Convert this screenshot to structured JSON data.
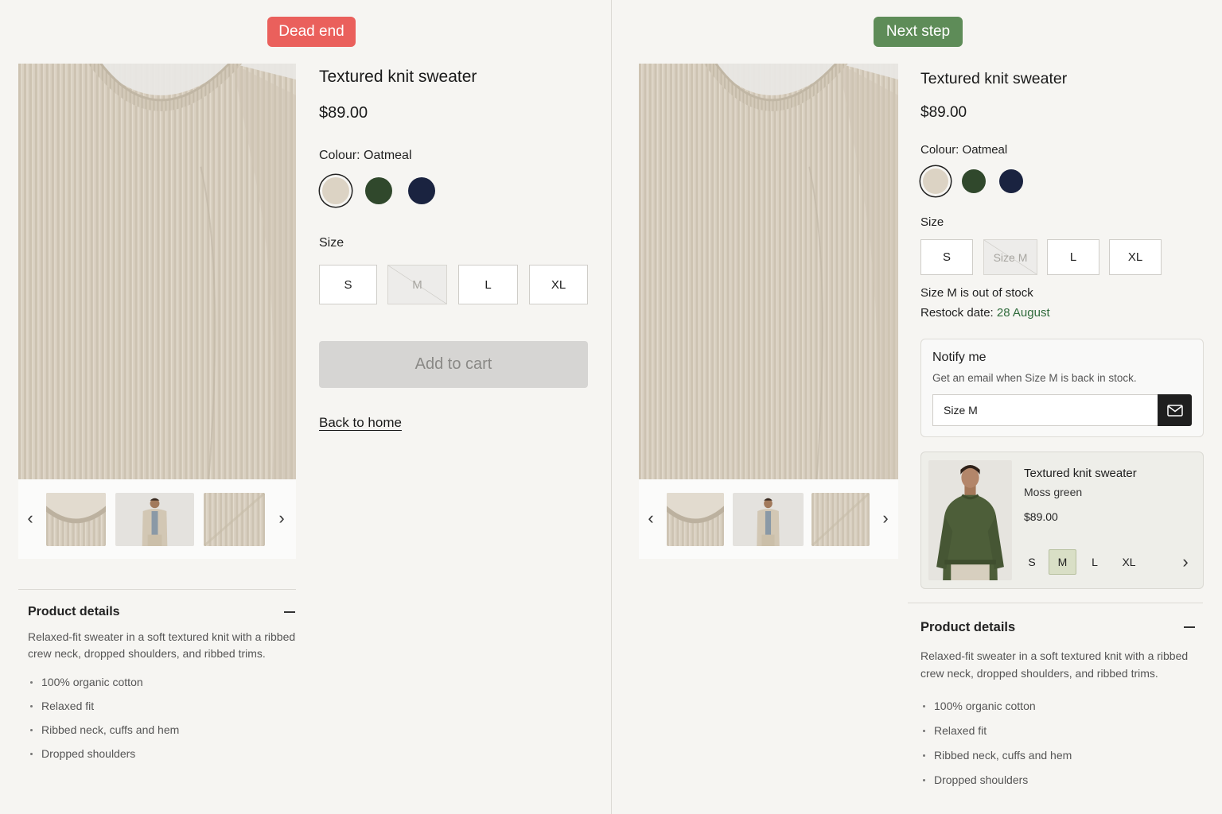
{
  "left": {
    "badge": "Dead end",
    "product": {
      "title": "Textured knit sweater",
      "price": "$89.00",
      "colour_label": "Colour: Oatmeal",
      "swatches": [
        {
          "name": "Oatmeal",
          "color": "#dcd3c4",
          "selected": true
        },
        {
          "name": "Moss green",
          "color": "#30482c",
          "selected": false
        },
        {
          "name": "Navy",
          "color": "#1a2340",
          "selected": false
        }
      ],
      "size_label": "Size",
      "sizes": [
        "S",
        "M",
        "L",
        "XL"
      ],
      "sold_out_size": "M",
      "add_to_cart": "Add to cart",
      "back_link": "Back to home"
    },
    "details": {
      "title": "Product details",
      "description": "Relaxed-fit sweater in a soft textured knit with a ribbed crew neck, dropped shoulders, and ribbed trims.",
      "bullets": [
        "100% organic cotton",
        "Relaxed fit",
        "Ribbed neck, cuffs and hem",
        "Dropped shoulders"
      ]
    }
  },
  "right": {
    "badge": "Next step",
    "product": {
      "title": "Textured knit sweater",
      "price": "$89.00",
      "colour_label": "Colour: Oatmeal",
      "swatches": [
        {
          "name": "Oatmeal",
          "color": "#dcd3c4",
          "selected": true
        },
        {
          "name": "Moss green",
          "color": "#30482c",
          "selected": false
        },
        {
          "name": "Navy",
          "color": "#1a2340",
          "selected": false
        }
      ],
      "size_label": "Size",
      "sizes": [
        "S",
        "Size M",
        "L",
        "XL"
      ],
      "oos_message": "Size M is out of stock",
      "restock_prefix": "Restock date: ",
      "restock_date": "28 August"
    },
    "notify": {
      "title": "Notify me",
      "subtitle": "Get an email when Size M is back in stock.",
      "input_value": "Size M",
      "button_icon": "mail-icon"
    },
    "alternative": {
      "title": "Textured knit sweater",
      "colour": "Moss green",
      "price": "$89.00",
      "sizes": [
        "S",
        "M",
        "L",
        "XL"
      ],
      "selected_size": "M"
    },
    "details": {
      "title": "Product details",
      "description": "Relaxed-fit sweater in a soft textured knit with a ribbed crew neck, dropped shoulders, and ribbed trims.",
      "bullets": [
        "100% organic cotton",
        "Relaxed fit",
        "Ribbed neck, cuffs and hem",
        "Dropped shoulders"
      ]
    }
  },
  "icons": {
    "prev": "chevron-left-icon",
    "next": "chevron-right-icon",
    "collapse": "minus-icon",
    "mail": "mail-icon"
  },
  "colors": {
    "dead_end_badge": "#ea605c",
    "next_step_badge": "#5e8c58",
    "restock_date": "#2f6a3b",
    "selected_alt_size": "#d9dfc6"
  }
}
